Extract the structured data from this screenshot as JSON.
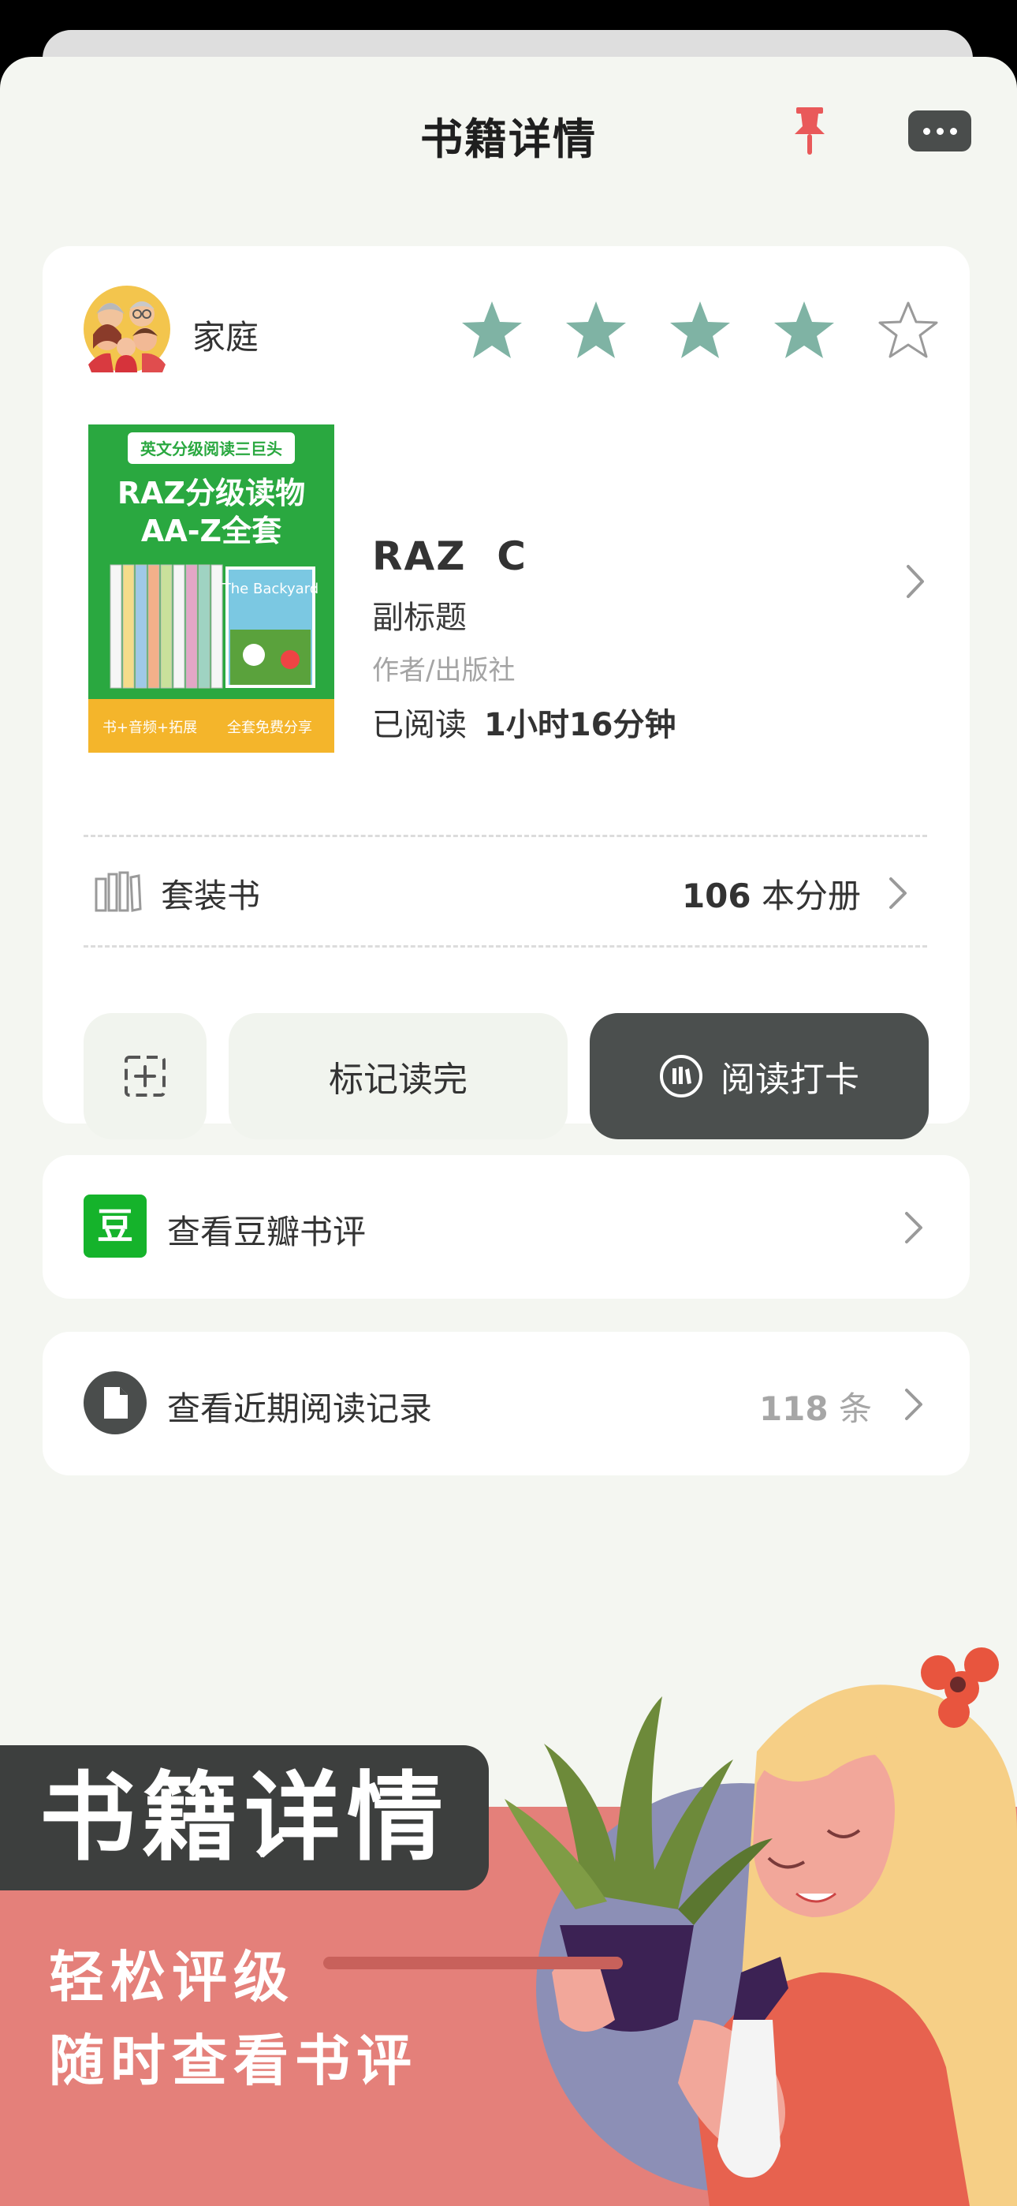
{
  "header": {
    "title": "书籍详情"
  },
  "category": {
    "label": "家庭"
  },
  "rating": {
    "value": 4,
    "max": 5
  },
  "book": {
    "cover": {
      "banner": "英文分级阅读三巨头",
      "line1": "RAZ分级读物",
      "line2": "AA-Z全套",
      "inner_book": "The Backyard",
      "footer_left": "书+音频+拓展",
      "footer_right": "全套免费分享"
    },
    "title": "RAZ  C",
    "subtitle": "副标题",
    "author": "作者/出版社",
    "read_prefix": "已阅读",
    "read_time": "1小时16分钟"
  },
  "set": {
    "label": "套装书",
    "count": "106",
    "unit": "本分册"
  },
  "actions": {
    "finish_label": "标记读完",
    "checkin_label": "阅读打卡"
  },
  "douban": {
    "icon_char": "豆",
    "label": "查看豆瓣书评"
  },
  "history": {
    "label": "查看近期阅读记录",
    "count": "118",
    "unit": "条"
  },
  "promo": {
    "title": "书籍详情",
    "line1": "轻松评级",
    "line2": "随时查看书评"
  },
  "colors": {
    "star_filled": "#7fb3a4",
    "pin": "#e9595a",
    "dark_button": "#4b4f4e",
    "douban_green": "#15b32b",
    "promo_bg": "#e4807a"
  }
}
